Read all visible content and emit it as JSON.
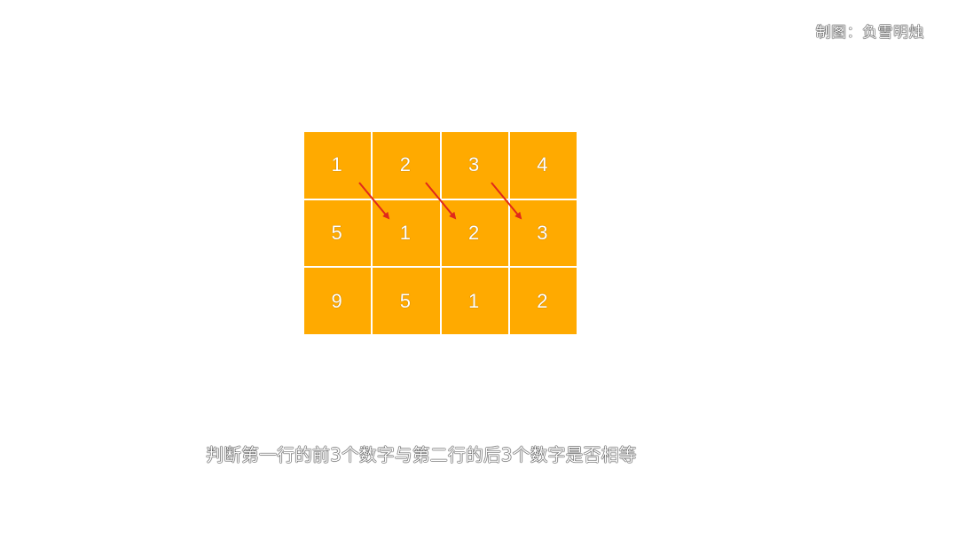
{
  "credit": "制图：负雪明烛",
  "grid": {
    "rows": [
      [
        "1",
        "2",
        "3",
        "4"
      ],
      [
        "5",
        "1",
        "2",
        "3"
      ],
      [
        "9",
        "5",
        "1",
        "2"
      ]
    ],
    "cell_color": "#ffaa00",
    "text_color": "#ffffff"
  },
  "arrow_color": "#e0281c",
  "caption": "判断第一行的前3个数字与第二行的后3个数字是否相等"
}
